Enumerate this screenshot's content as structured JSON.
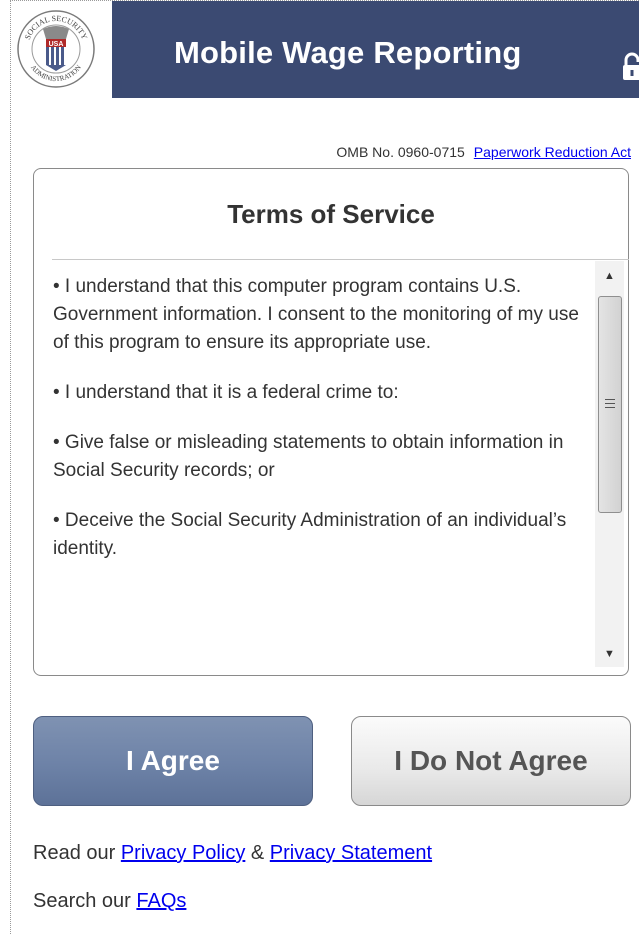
{
  "header": {
    "title": "Mobile Wage Reporting",
    "logo_name": "ssa-seal",
    "logo_text_top": "SOCIAL SECURITY",
    "logo_text_bottom": "ADMINISTRATION",
    "logo_center": "USA",
    "lock_icon": "lock-icon",
    "banner_color": "#3b4a72"
  },
  "omb": {
    "number": "OMB No. 0960-0715",
    "link_label": "Paperwork Reduction Act"
  },
  "terms": {
    "title": "Terms of Service",
    "paragraphs": [
      "• I understand that this computer program contains U.S. Government information. I consent to the monitoring of my use of this program to ensure its appropriate use.",
      "• I understand that it is a federal crime to:",
      "• Give false or misleading statements to obtain information in Social Security records; or",
      "• Deceive the Social Security Administration of an individual’s identity."
    ]
  },
  "buttons": {
    "agree_label": "I Agree",
    "disagree_label": "I Do Not Agree",
    "agree_color": "#6d82a7"
  },
  "footer": {
    "privacy_prefix": "Read our ",
    "privacy_policy_link": "Privacy Policy",
    "privacy_joiner": " & ",
    "privacy_statement_link": "Privacy Statement",
    "faq_prefix": "Search our ",
    "faq_link": "FAQs"
  }
}
